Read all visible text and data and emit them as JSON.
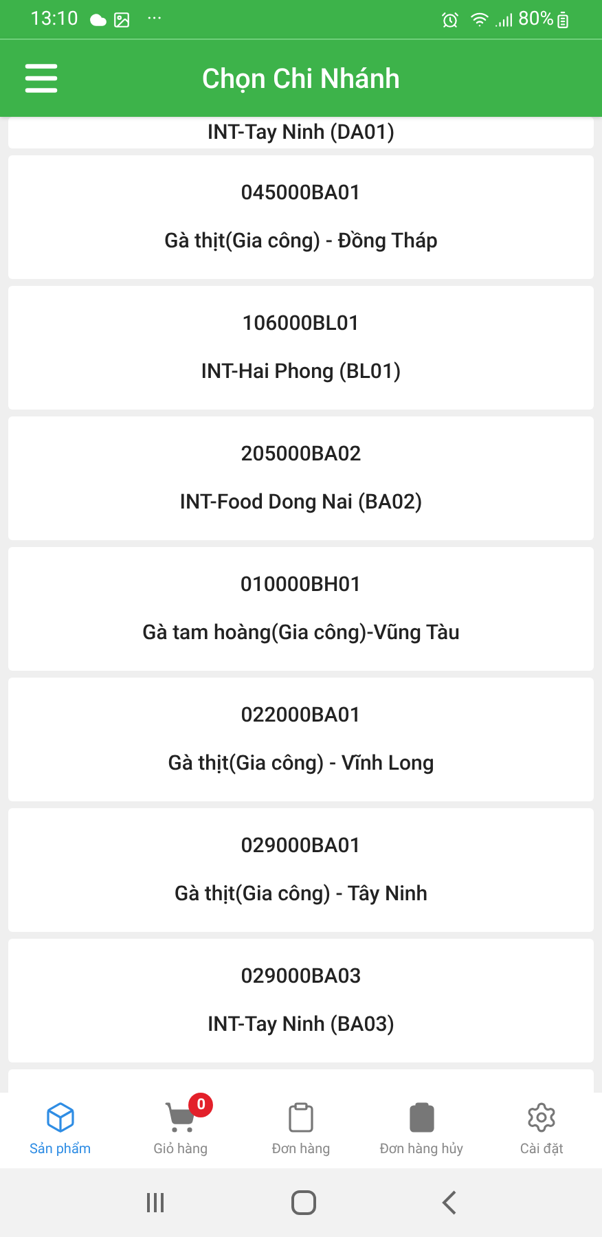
{
  "status_bar": {
    "time": "13:10",
    "more": "···",
    "battery": "80%"
  },
  "header": {
    "title": "Chọn Chi Nhánh"
  },
  "partial_branch": {
    "name": "INT-Tay Ninh (DA01)"
  },
  "branches": [
    {
      "code": "045000BA01",
      "name": "Gà thịt(Gia công) - Đồng Tháp"
    },
    {
      "code": "106000BL01",
      "name": "INT-Hai Phong (BL01)"
    },
    {
      "code": "205000BA02",
      "name": "INT-Food Dong Nai (BA02)"
    },
    {
      "code": "010000BH01",
      "name": "Gà tam hoàng(Gia công)-Vũng Tàu"
    },
    {
      "code": "022000BA01",
      "name": "Gà thịt(Gia công) - Vĩnh Long"
    },
    {
      "code": "029000BA01",
      "name": "Gà thịt(Gia công) - Tây Ninh"
    },
    {
      "code": "029000BA03",
      "name": "INT-Tay Ninh (BA03)"
    }
  ],
  "tabs": [
    {
      "kind": "box",
      "label": "Sản phẩm",
      "selected": true
    },
    {
      "kind": "cart",
      "label": "Giỏ hàng",
      "selected": false,
      "badge": "0"
    },
    {
      "kind": "clipboard",
      "label": "Đơn hàng",
      "selected": false
    },
    {
      "kind": "clipboard-filled",
      "label": "Đơn hàng hủy",
      "selected": false
    },
    {
      "kind": "gear",
      "label": "Cài đặt",
      "selected": false
    }
  ]
}
